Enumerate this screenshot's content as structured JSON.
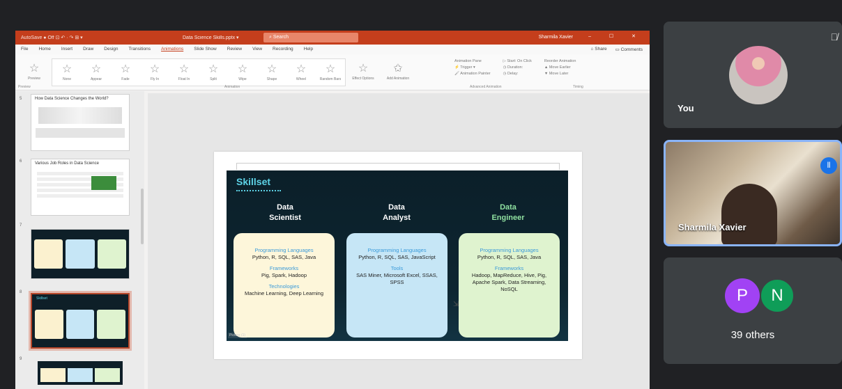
{
  "ppt": {
    "titlebar": {
      "quick_access": "AutoSave ● Off  ⊡  ↶ · ↷  ⊞ ▾",
      "doc_name": "Data Science Skills.pptx ▾",
      "search": "⌕ Search",
      "user": "Sharmila Xavier",
      "window_buttons": "–  ☐  ✕"
    },
    "menu": [
      "File",
      "Home",
      "Insert",
      "Draw",
      "Design",
      "Transitions",
      "Animations",
      "Slide Show",
      "Review",
      "View",
      "Recording",
      "Help"
    ],
    "menu_active_index": 6,
    "menu_right": [
      "⌂ Share",
      "▭ Comments"
    ],
    "ribbon": {
      "preview": "Preview",
      "animations": [
        "None",
        "Appear",
        "Fade",
        "Fly In",
        "Float In",
        "Split",
        "Wipe",
        "Shape",
        "Wheel",
        "Random Bars"
      ],
      "effect_options": "Effect Options",
      "add_animation": "Add Animation",
      "right_groups": [
        [
          "Animation Pane",
          "⚡ Trigger ▾",
          "🖌 Animation Painter"
        ],
        [
          "▷ Start: On Click",
          "◷ Duration:",
          "◷ Delay:"
        ],
        [
          "Reorder Animation",
          "▲ Move Earlier",
          "▼ Move Later"
        ]
      ],
      "groups": [
        "Preview",
        "Animation",
        "Advanced Animation",
        "Timing"
      ]
    },
    "thumbnails": [
      {
        "num": "5",
        "title": "How Data Science Changes the World?"
      },
      {
        "num": "6",
        "title": "Various Job Roles in Data Science"
      },
      {
        "num": "7",
        "title": ""
      },
      {
        "num": "8",
        "title": "Skillset"
      },
      {
        "num": "9",
        "title": ""
      }
    ],
    "slide": {
      "title": "Skillset",
      "columns": [
        {
          "head": "Data\nScientist",
          "color": "#fdf6da",
          "sections": [
            {
              "cat": "Programming Languages",
              "val": "Python, R, SQL, SAS, Java"
            },
            {
              "cat": "Frameworks",
              "val": "Pig, Spark, Hadoop"
            },
            {
              "cat": "Technologies",
              "val": "Machine Learning, Deep Learning"
            }
          ]
        },
        {
          "head": "Data\nAnalyst",
          "color": "#c6e6f6",
          "sections": [
            {
              "cat": "Programming Languages",
              "val": "Python, R, SQL, SAS, JavaScript"
            },
            {
              "cat": "Tools",
              "val": "SAS Miner, Microsoft Excel, SSAS, SPSS"
            }
          ]
        },
        {
          "head": "Data\nEngineer",
          "color": "#dff3cf",
          "sections": [
            {
              "cat": "Programming Languages",
              "val": "Python, R, SQL, SAS, Java"
            },
            {
              "cat": "Frameworks",
              "val": "Hadoop, MapReduce, Hive, Pig, Apache Spark, Data Streaming, NoSQL"
            }
          ]
        }
      ],
      "presenter_tag": "Picture (1)"
    }
  },
  "participants": {
    "self": {
      "label": "You"
    },
    "speaker": {
      "label": "Sharmila Xavier"
    },
    "others": {
      "initials": [
        "P",
        "N"
      ],
      "colors": [
        "#a142f4",
        "#0f9d58"
      ],
      "label": "39 others"
    }
  }
}
